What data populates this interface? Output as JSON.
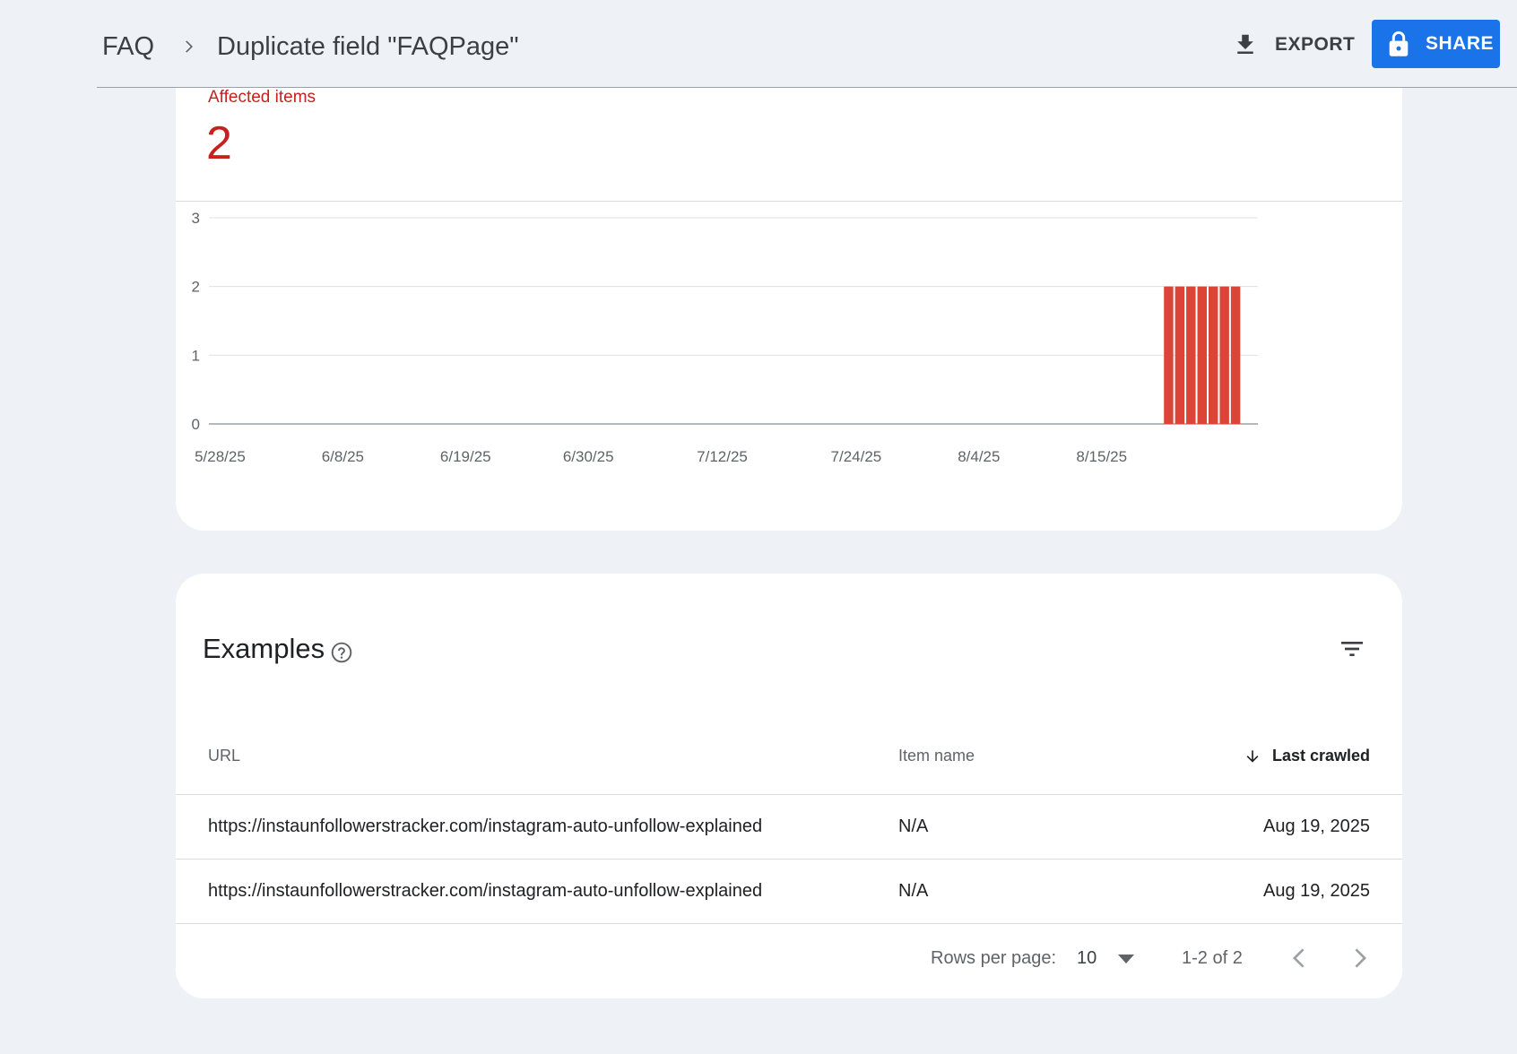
{
  "header": {
    "breadcrumb_root": "FAQ",
    "title": "Duplicate field \"FAQPage\"",
    "export_label": "EXPORT",
    "share_label": "SHARE"
  },
  "summary": {
    "affected_label": "Affected items",
    "affected_value": "2"
  },
  "chart_data": {
    "type": "bar",
    "title": "",
    "xlabel": "",
    "ylabel": "",
    "ylim": [
      0,
      3
    ],
    "yticks": [
      "0",
      "1",
      "2",
      "3"
    ],
    "xticks": [
      "5/28/25",
      "6/8/25",
      "6/19/25",
      "6/30/25",
      "7/12/25",
      "7/24/25",
      "8/4/25",
      "8/15/25"
    ],
    "categories": [
      "8/21/25",
      "8/22/25",
      "8/23/25",
      "8/24/25",
      "8/25/25",
      "8/26/25",
      "8/27/25"
    ],
    "values": [
      2,
      2,
      2,
      2,
      2,
      2,
      2
    ],
    "x_domain": [
      "5/27/25",
      "8/29/25"
    ],
    "bar_color": "#db4437",
    "grid": true
  },
  "examples": {
    "title": "Examples",
    "columns": {
      "url": "URL",
      "item_name": "Item name",
      "last_crawled": "Last crawled"
    },
    "rows": [
      {
        "url": "https://instaunfollowerstracker.com/instagram-auto-unfollow-explained",
        "item_name": "N/A",
        "last_crawled": "Aug 19, 2025"
      },
      {
        "url": "https://instaunfollowerstracker.com/instagram-auto-unfollow-explained",
        "item_name": "N/A",
        "last_crawled": "Aug 19, 2025"
      }
    ],
    "pagination": {
      "rows_per_page_label": "Rows per page:",
      "rows_per_page": "10",
      "range": "1-2 of 2"
    }
  },
  "colors": {
    "accent": "#1a73e8",
    "error": "#c5221f",
    "background": "#eef2f7"
  },
  "icons": [
    "chevron-right-icon",
    "download-icon",
    "lock-icon",
    "help-icon",
    "filter-icon",
    "arrow-down-icon",
    "dropdown-icon",
    "chevron-left-icon",
    "chevron-right-icon"
  ]
}
